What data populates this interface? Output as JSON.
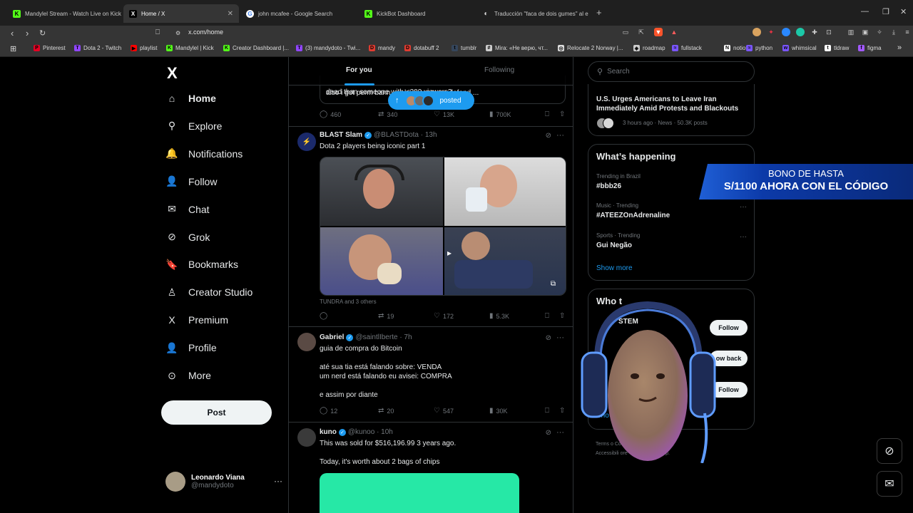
{
  "browser": {
    "tabs": [
      {
        "title": "Mandylel Stream - Watch Live on Kick",
        "color": "#53fc18",
        "glyph": "K",
        "active": false
      },
      {
        "title": "Home / X",
        "color": "#ffffff",
        "glyph": "X",
        "active": true
      },
      {
        "title": "john mcafee - Google Search",
        "color": "#ffffff",
        "glyph": "G",
        "active": false
      },
      {
        "title": "KickBot Dashboard",
        "color": "#53fc18",
        "glyph": "K",
        "active": false
      },
      {
        "title": "Traducción \"faca de dois gumes\" al e",
        "color": "#dddddd",
        "glyph": "◐",
        "active": false
      }
    ],
    "new_tab": "+",
    "url": "x.com/home",
    "bookmarks": [
      {
        "label": "Pinterest",
        "color": "#e60023",
        "glyph": "P"
      },
      {
        "label": "Dota 2 - Twitch",
        "color": "#9146ff",
        "glyph": "T"
      },
      {
        "label": "playlist",
        "color": "#ff0000",
        "glyph": "▶"
      },
      {
        "label": "Mandylel | Kick",
        "color": "#53fc18",
        "glyph": "K"
      },
      {
        "label": "Creator Dashboard |...",
        "color": "#53fc18",
        "glyph": "K"
      },
      {
        "label": "(3) mandydoto - Twi...",
        "color": "#9146ff",
        "glyph": "T"
      },
      {
        "label": "mandy",
        "color": "#e03c31",
        "glyph": "D"
      },
      {
        "label": "dotabuff 2",
        "color": "#e03c31",
        "glyph": "D"
      },
      {
        "label": "tumblr",
        "color": "#35465c",
        "glyph": "t"
      },
      {
        "label": "Mira: «Не верю, чт...",
        "color": "#cccccc",
        "glyph": "#"
      },
      {
        "label": "Relocate 2 Norway |...",
        "color": "#dddddd",
        "glyph": "◎"
      },
      {
        "label": "roadmap",
        "color": "#cccccc",
        "glyph": "◈"
      },
      {
        "label": "fullstack",
        "color": "#7a55ff",
        "glyph": "≈"
      },
      {
        "label": "notion",
        "color": "#ffffff",
        "glyph": "N"
      },
      {
        "label": "python",
        "color": "#7a55ff",
        "glyph": "≈"
      },
      {
        "label": "whimsical",
        "color": "#7a55ff",
        "glyph": "w"
      },
      {
        "label": "tldraw",
        "color": "#ffffff",
        "glyph": "t"
      },
      {
        "label": "figma",
        "color": "#a259ff",
        "glyph": "f"
      }
    ]
  },
  "sidebar": {
    "logo": "X",
    "items": [
      {
        "label": "Home",
        "icon": "home-icon",
        "glyph": "⌂"
      },
      {
        "label": "Explore",
        "icon": "search-icon",
        "glyph": "⚲"
      },
      {
        "label": "Notifications",
        "icon": "bell-icon",
        "glyph": "🔔"
      },
      {
        "label": "Follow",
        "icon": "person-add-icon",
        "glyph": "👤"
      },
      {
        "label": "Chat",
        "icon": "mail-icon",
        "glyph": "✉"
      },
      {
        "label": "Grok",
        "icon": "grok-icon",
        "glyph": "⊘"
      },
      {
        "label": "Bookmarks",
        "icon": "bookmark-icon",
        "glyph": "🔖"
      },
      {
        "label": "Creator Studio",
        "icon": "creator-studio-icon",
        "glyph": "♙"
      },
      {
        "label": "Premium",
        "icon": "x-premium-icon",
        "glyph": "X"
      },
      {
        "label": "Profile",
        "icon": "profile-icon",
        "glyph": "👤"
      },
      {
        "label": "More",
        "icon": "more-circle-icon",
        "glyph": "⊙"
      }
    ],
    "post_label": "Post",
    "account": {
      "name": "Leonardo Viana",
      "handle": "@mandydoto",
      "menu": "···"
    }
  },
  "feed": {
    "tabs": {
      "for_you": "For you",
      "following": "Following"
    },
    "posted_pill": {
      "arrow": "↑",
      "label": "posted"
    },
    "top_tweet": {
      "line1": "dead than someone with <300 viewers?",
      "line2": "also i got perm bann...                               ...he's not tryna defend ...",
      "reply": "460",
      "retweet": "340",
      "like": "13K",
      "views": "700K"
    },
    "tweets": [
      {
        "name": "BLAST Slam",
        "handle": "@BLASTDota · 13h",
        "text": "Dota 2 players being iconic part 1",
        "media_caption": "TUNDRA and 3 others",
        "reply": "",
        "retweet": "19",
        "like": "172",
        "views": "5.3K"
      },
      {
        "name": "Gabriel",
        "handle": "@saintlIberte · 7h",
        "text": "guia de compra do Bitcoin\n\naté sua tia está falando sobre: VENDA\num nerd está falando eu avisei: COMPRA\n\ne assim por diante",
        "reply": "12",
        "retweet": "20",
        "like": "547",
        "views": "30K"
      },
      {
        "name": "kuno",
        "handle": "@kunoo · 10h",
        "text": "This was sold for $516,196.99 3 years ago.\n\nToday, it's worth about 2 bags of chips",
        "reply": "",
        "retweet": "",
        "like": "",
        "views": ""
      }
    ]
  },
  "right": {
    "search_placeholder": "Search",
    "news": {
      "title": "U.S. Urges Americans to Leave Iran Immediately Amid Protests and Blackouts",
      "meta": "3 hours ago · News · 50.3K posts"
    },
    "happening": {
      "title": "What’s happening",
      "trends": [
        {
          "meta": "Trending in Brazil",
          "name": "#bbb26"
        },
        {
          "meta": "Music · Trending",
          "name": "#ATEEZOnAdrenaline"
        },
        {
          "meta": "Sports · Trending",
          "name": "Gui Negão"
        }
      ],
      "show_more": "Show more"
    },
    "who": {
      "title": "Who t",
      "first_name": "STEM",
      "buttons": [
        "Follow",
        "ow back",
        "Follow"
      ],
      "show": "Sho"
    },
    "footer": {
      "line1": "Terms o                                    Cookie Policy  |",
      "line2": "Accessibili                            ore ···    © 2026 X Corp."
    }
  },
  "overlays": {
    "promo_line1": "BONO DE HASTA",
    "promo_line2": "S/1100 AHORA CON EL CÓDIGO"
  }
}
